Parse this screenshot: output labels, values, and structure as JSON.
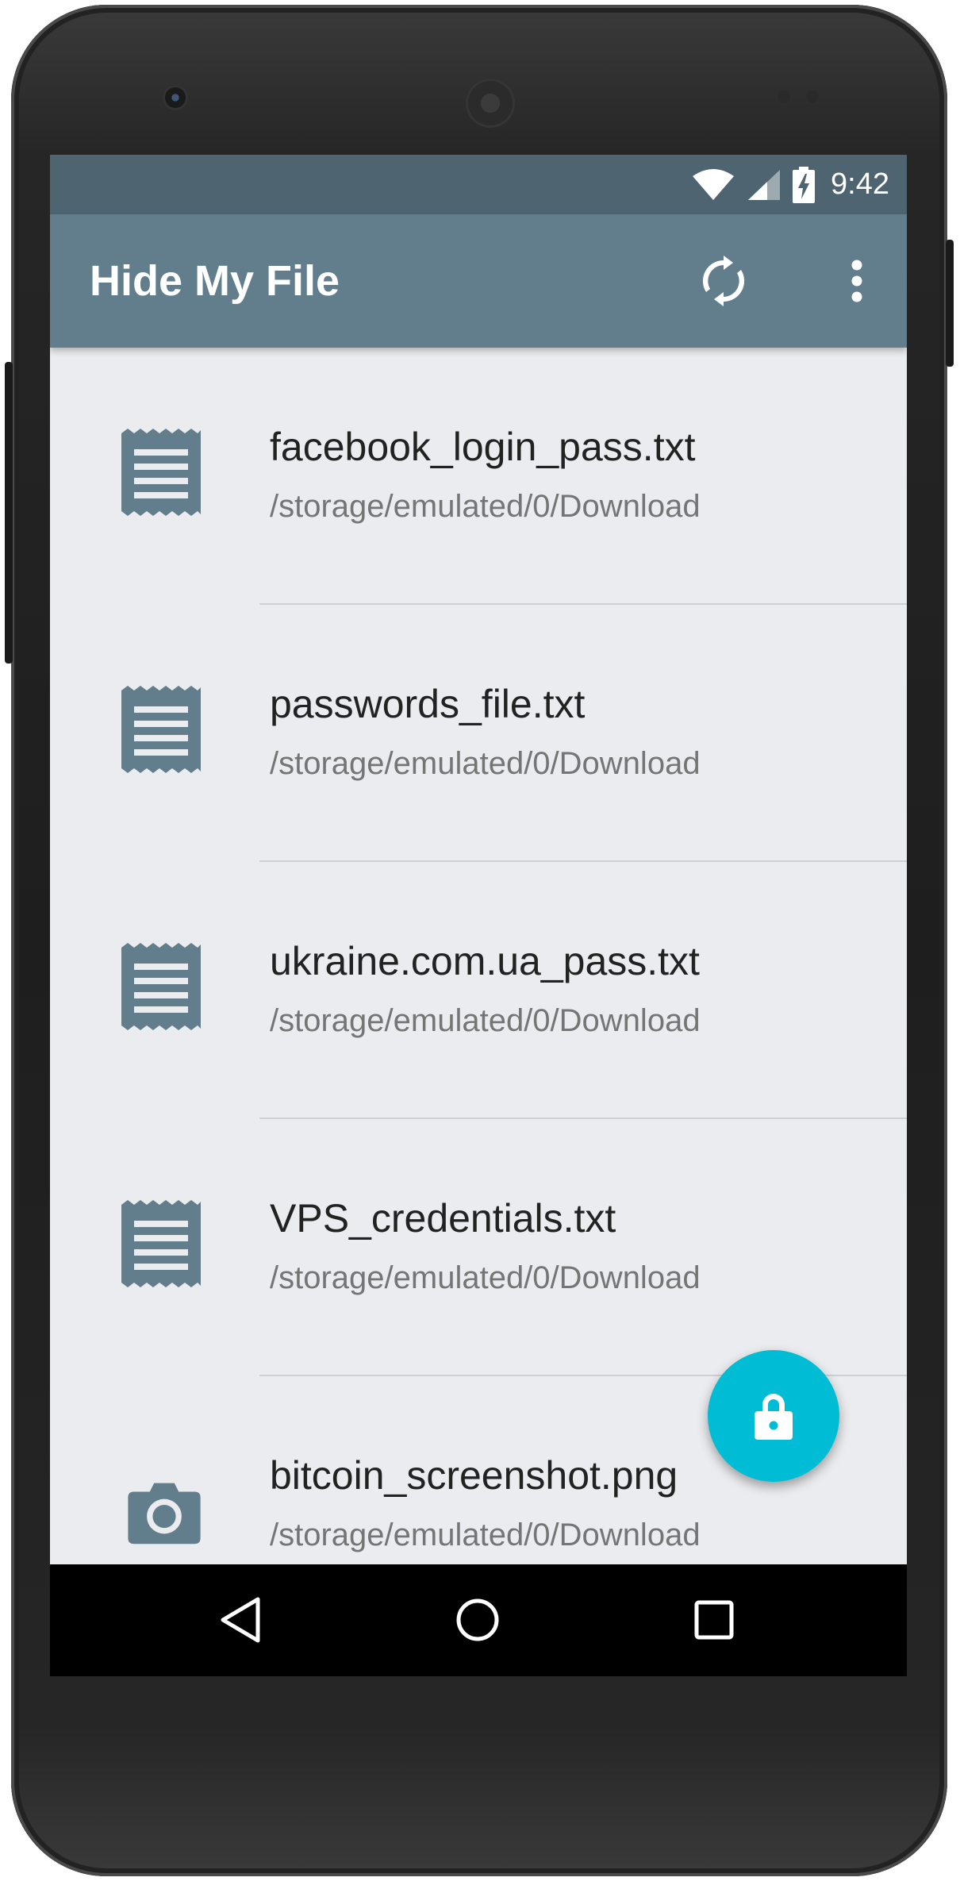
{
  "status_bar": {
    "time": "9:42",
    "icons": [
      "wifi-icon",
      "cell-signal-icon",
      "battery-charging-icon"
    ]
  },
  "app_bar": {
    "title": "Hide My File",
    "actions": [
      "sync-icon",
      "more-vert-icon"
    ]
  },
  "files": [
    {
      "name": "facebook_login_pass.txt",
      "path": "/storage/emulated/0/Download",
      "icon": "text-file-icon"
    },
    {
      "name": "passwords_file.txt",
      "path": "/storage/emulated/0/Download",
      "icon": "text-file-icon"
    },
    {
      "name": "ukraine.com.ua_pass.txt",
      "path": "/storage/emulated/0/Download",
      "icon": "text-file-icon"
    },
    {
      "name": "VPS_credentials.txt",
      "path": "/storage/emulated/0/Download",
      "icon": "text-file-icon"
    },
    {
      "name": "bitcoin_screenshot.png",
      "path": "/storage/emulated/0/Download",
      "icon": "camera-icon"
    }
  ],
  "fab": {
    "icon": "lock-icon",
    "color": "#00bcd4"
  },
  "nav_bar": {
    "buttons": [
      "back-icon",
      "home-icon",
      "recents-icon"
    ]
  },
  "colors": {
    "status_bar": "#4e6470",
    "app_bar": "#627d8b",
    "background": "#ebecef",
    "icon": "#627d8b"
  }
}
